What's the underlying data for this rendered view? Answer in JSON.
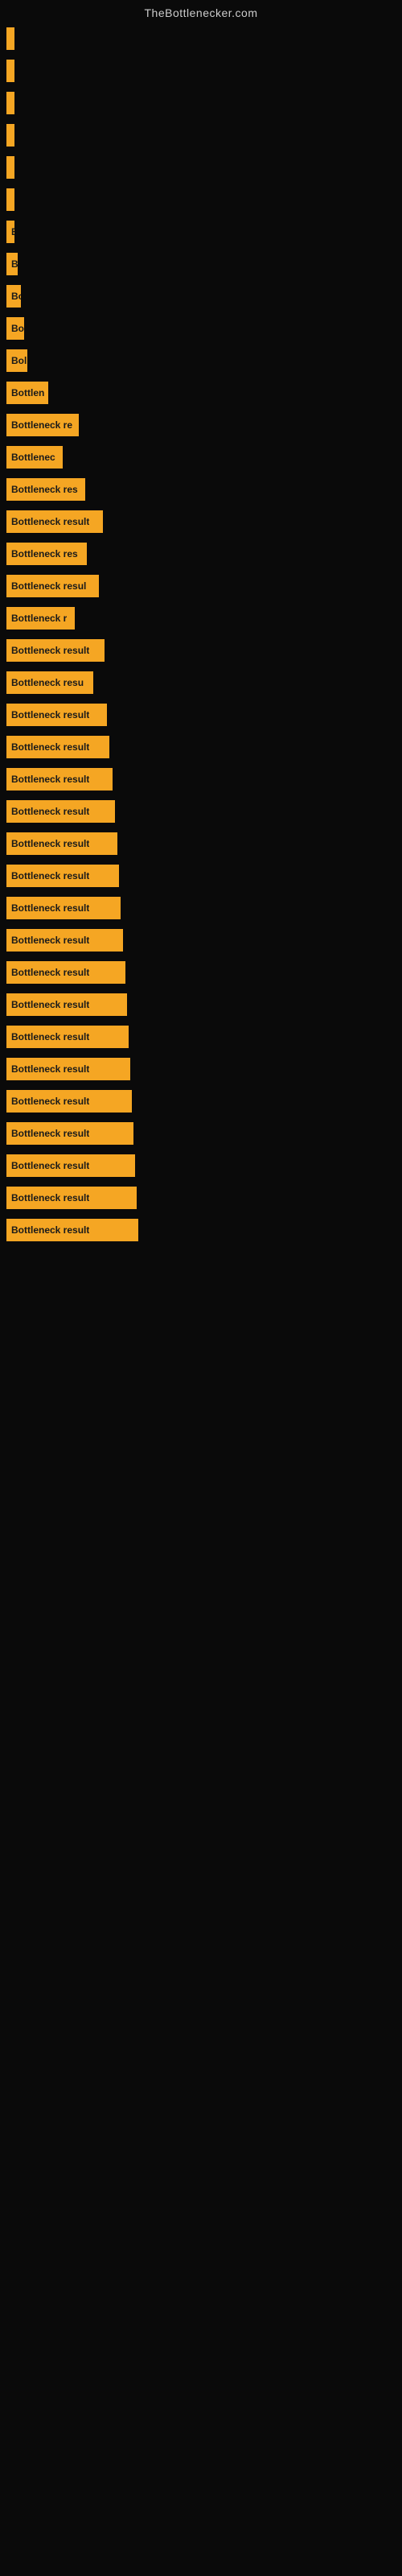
{
  "site_title": "TheBottlenecker.com",
  "bars": [
    {
      "label": "",
      "width": 2
    },
    {
      "label": "",
      "width": 3
    },
    {
      "label": "",
      "width": 4
    },
    {
      "label": "",
      "width": 3
    },
    {
      "label": "",
      "width": 3
    },
    {
      "label": "",
      "width": 4
    },
    {
      "label": "B",
      "width": 8
    },
    {
      "label": "Bo",
      "width": 14
    },
    {
      "label": "Bo",
      "width": 18
    },
    {
      "label": "Bo",
      "width": 22
    },
    {
      "label": "Bol",
      "width": 26
    },
    {
      "label": "Bottlen",
      "width": 52
    },
    {
      "label": "Bottleneck re",
      "width": 90
    },
    {
      "label": "Bottlenec",
      "width": 70
    },
    {
      "label": "Bottleneck res",
      "width": 98
    },
    {
      "label": "Bottleneck result",
      "width": 120
    },
    {
      "label": "Bottleneck res",
      "width": 100
    },
    {
      "label": "Bottleneck resul",
      "width": 115
    },
    {
      "label": "Bottleneck r",
      "width": 85
    },
    {
      "label": "Bottleneck result",
      "width": 122
    },
    {
      "label": "Bottleneck resu",
      "width": 108
    },
    {
      "label": "Bottleneck result",
      "width": 125
    },
    {
      "label": "Bottleneck result",
      "width": 128
    },
    {
      "label": "Bottleneck result",
      "width": 132
    },
    {
      "label": "Bottleneck result",
      "width": 135
    },
    {
      "label": "Bottleneck result",
      "width": 138
    },
    {
      "label": "Bottleneck result",
      "width": 140
    },
    {
      "label": "Bottleneck result",
      "width": 142
    },
    {
      "label": "Bottleneck result",
      "width": 145
    },
    {
      "label": "Bottleneck result",
      "width": 148
    },
    {
      "label": "Bottleneck result",
      "width": 150
    },
    {
      "label": "Bottleneck result",
      "width": 152
    },
    {
      "label": "Bottleneck result",
      "width": 154
    },
    {
      "label": "Bottleneck result",
      "width": 156
    },
    {
      "label": "Bottleneck result",
      "width": 158
    },
    {
      "label": "Bottleneck result",
      "width": 160
    },
    {
      "label": "Bottleneck result",
      "width": 162
    },
    {
      "label": "Bottleneck result",
      "width": 164
    }
  ]
}
